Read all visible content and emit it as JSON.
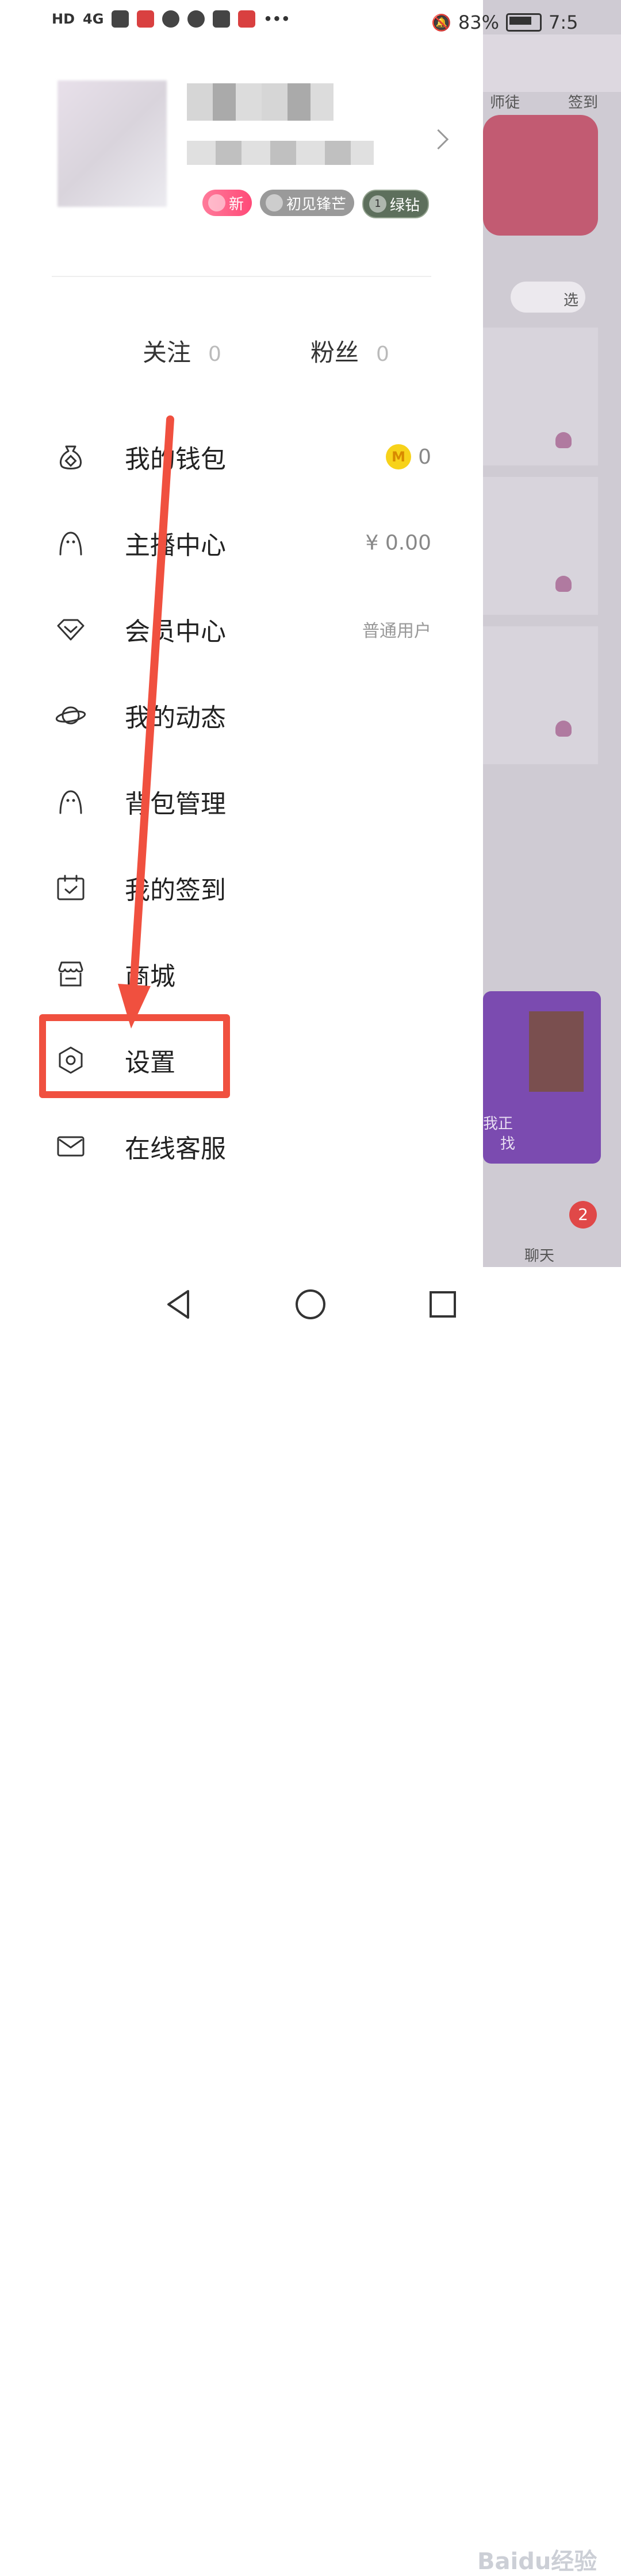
{
  "status_bar": {
    "left_labels": [
      "HD",
      "4G"
    ],
    "battery_percent": "83%",
    "time": "7:5"
  },
  "profile": {
    "badges": {
      "new": "新",
      "level": "初见锋芒",
      "vip": "绿钻",
      "vip_level": "1"
    }
  },
  "social": {
    "following_label": "关注",
    "following_count": "0",
    "followers_label": "粉丝",
    "followers_count": "0"
  },
  "menu": [
    {
      "label": "我的钱包",
      "icon": "wallet-icon",
      "value": "0",
      "coin_label": "M"
    },
    {
      "label": "主播中心",
      "icon": "host-icon",
      "value": "¥ 0.00"
    },
    {
      "label": "会员中心",
      "icon": "diamond-icon",
      "value": "普通用户"
    },
    {
      "label": "我的动态",
      "icon": "planet-icon",
      "value": ""
    },
    {
      "label": "背包管理",
      "icon": "backpack-icon",
      "value": ""
    },
    {
      "label": "我的签到",
      "icon": "calendar-check-icon",
      "value": ""
    },
    {
      "label": "商城",
      "icon": "store-icon",
      "value": ""
    },
    {
      "label": "设置",
      "icon": "settings-icon",
      "value": ""
    },
    {
      "label": "在线客服",
      "icon": "mail-icon",
      "value": ""
    }
  ],
  "background_app": {
    "tab_master": "师徒",
    "tab_checkin": "签到",
    "filter_label": "选",
    "banner_text_1": "我正",
    "banner_text_2": "找",
    "chat_label": "聊天",
    "chat_badge": "2"
  },
  "watermark": "Baidu经验",
  "colors": {
    "annotation_red": "#f0503f",
    "badge_pink": "#ff4a78",
    "coin_yellow": "#f7d21a"
  }
}
